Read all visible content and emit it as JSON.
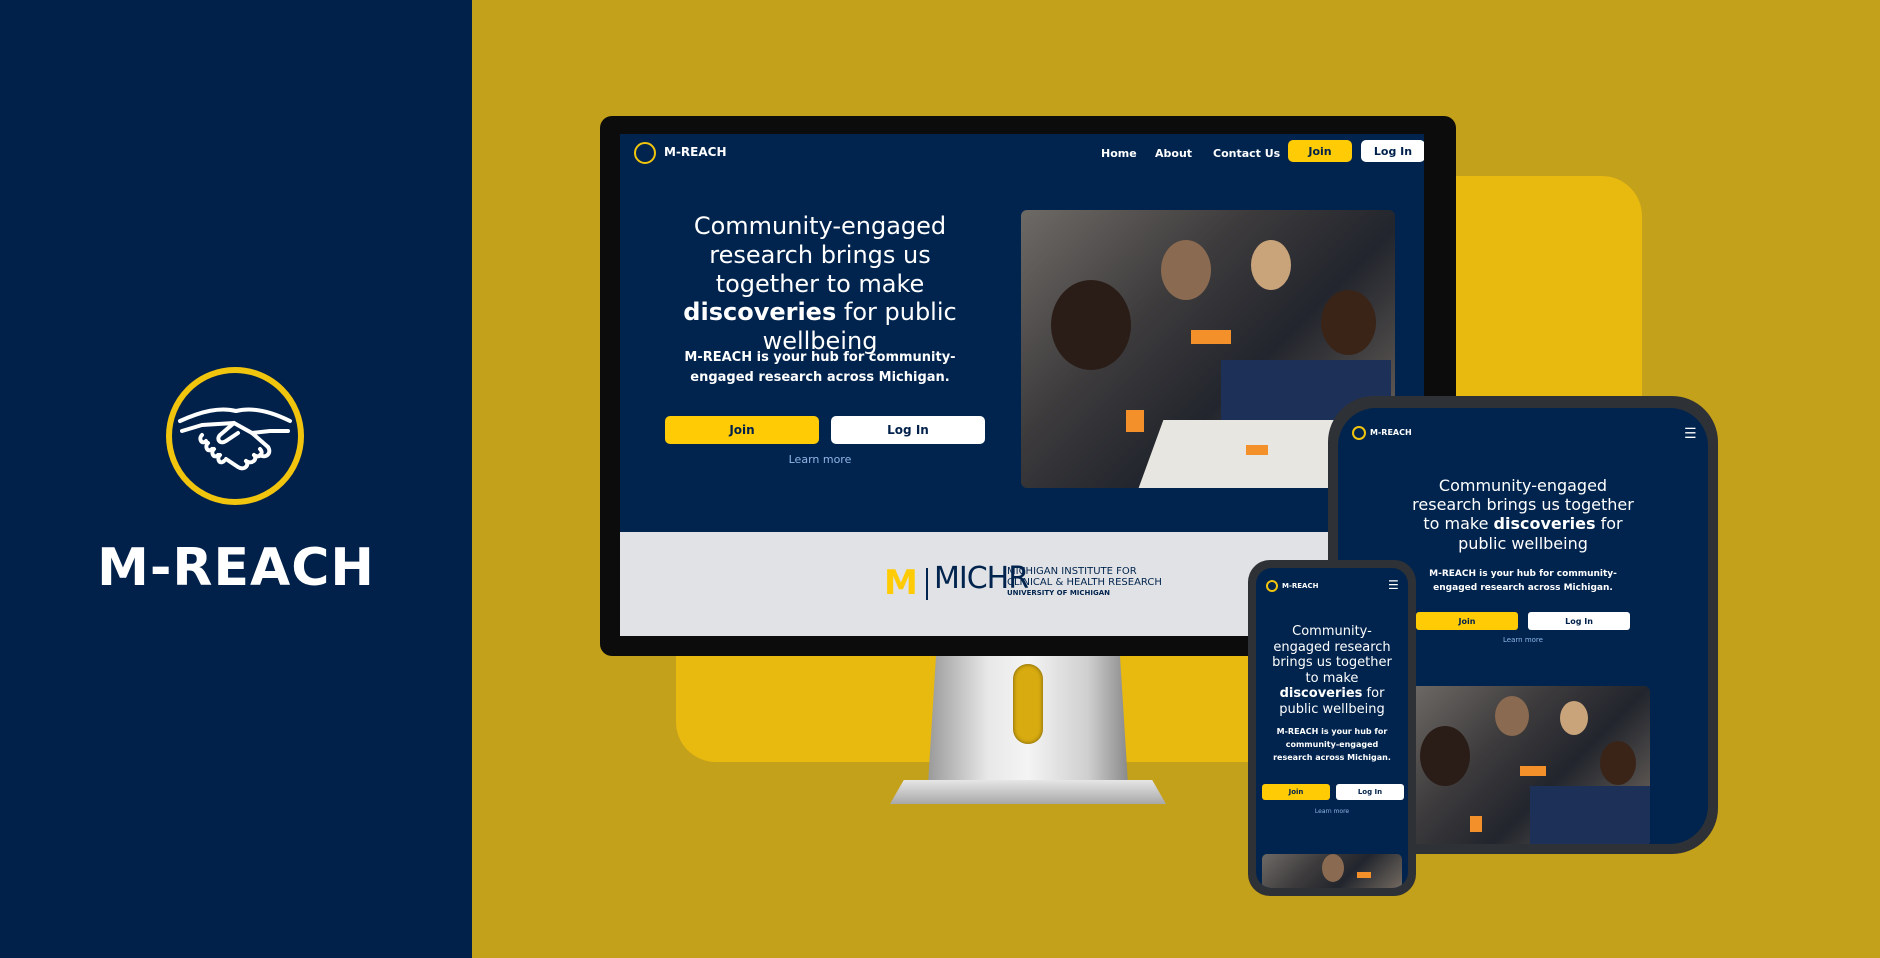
{
  "brand": {
    "name": "M-REACH",
    "logo_icon": "handshake-icon"
  },
  "colors": {
    "navy": "#01214a",
    "maize": "#ffcb05",
    "gold_bg": "#c4a11a"
  },
  "site": {
    "brand_name": "M-REACH",
    "nav": {
      "home": "Home",
      "about": "About",
      "contact": "Contact Us",
      "join": "Join",
      "login": "Log In"
    },
    "hero": {
      "title_part1": "Community-engaged research brings us together to make ",
      "title_bold": "discoveries",
      "title_part2": " for public wellbeing",
      "subtitle": "M-REACH is your hub for community-engaged research across Michigan.",
      "join_button": "Join",
      "login_button": "Log In",
      "learn_more": "Learn more"
    },
    "partner": {
      "block_m": "M",
      "acronym": "MICHR",
      "line1": "MICHIGAN INSTITUTE FOR",
      "line2": "CLINICAL & HEALTH RESEARCH",
      "line3": "UNIVERSITY OF MICHIGAN"
    },
    "menu_icon": "hamburger-menu-icon"
  }
}
